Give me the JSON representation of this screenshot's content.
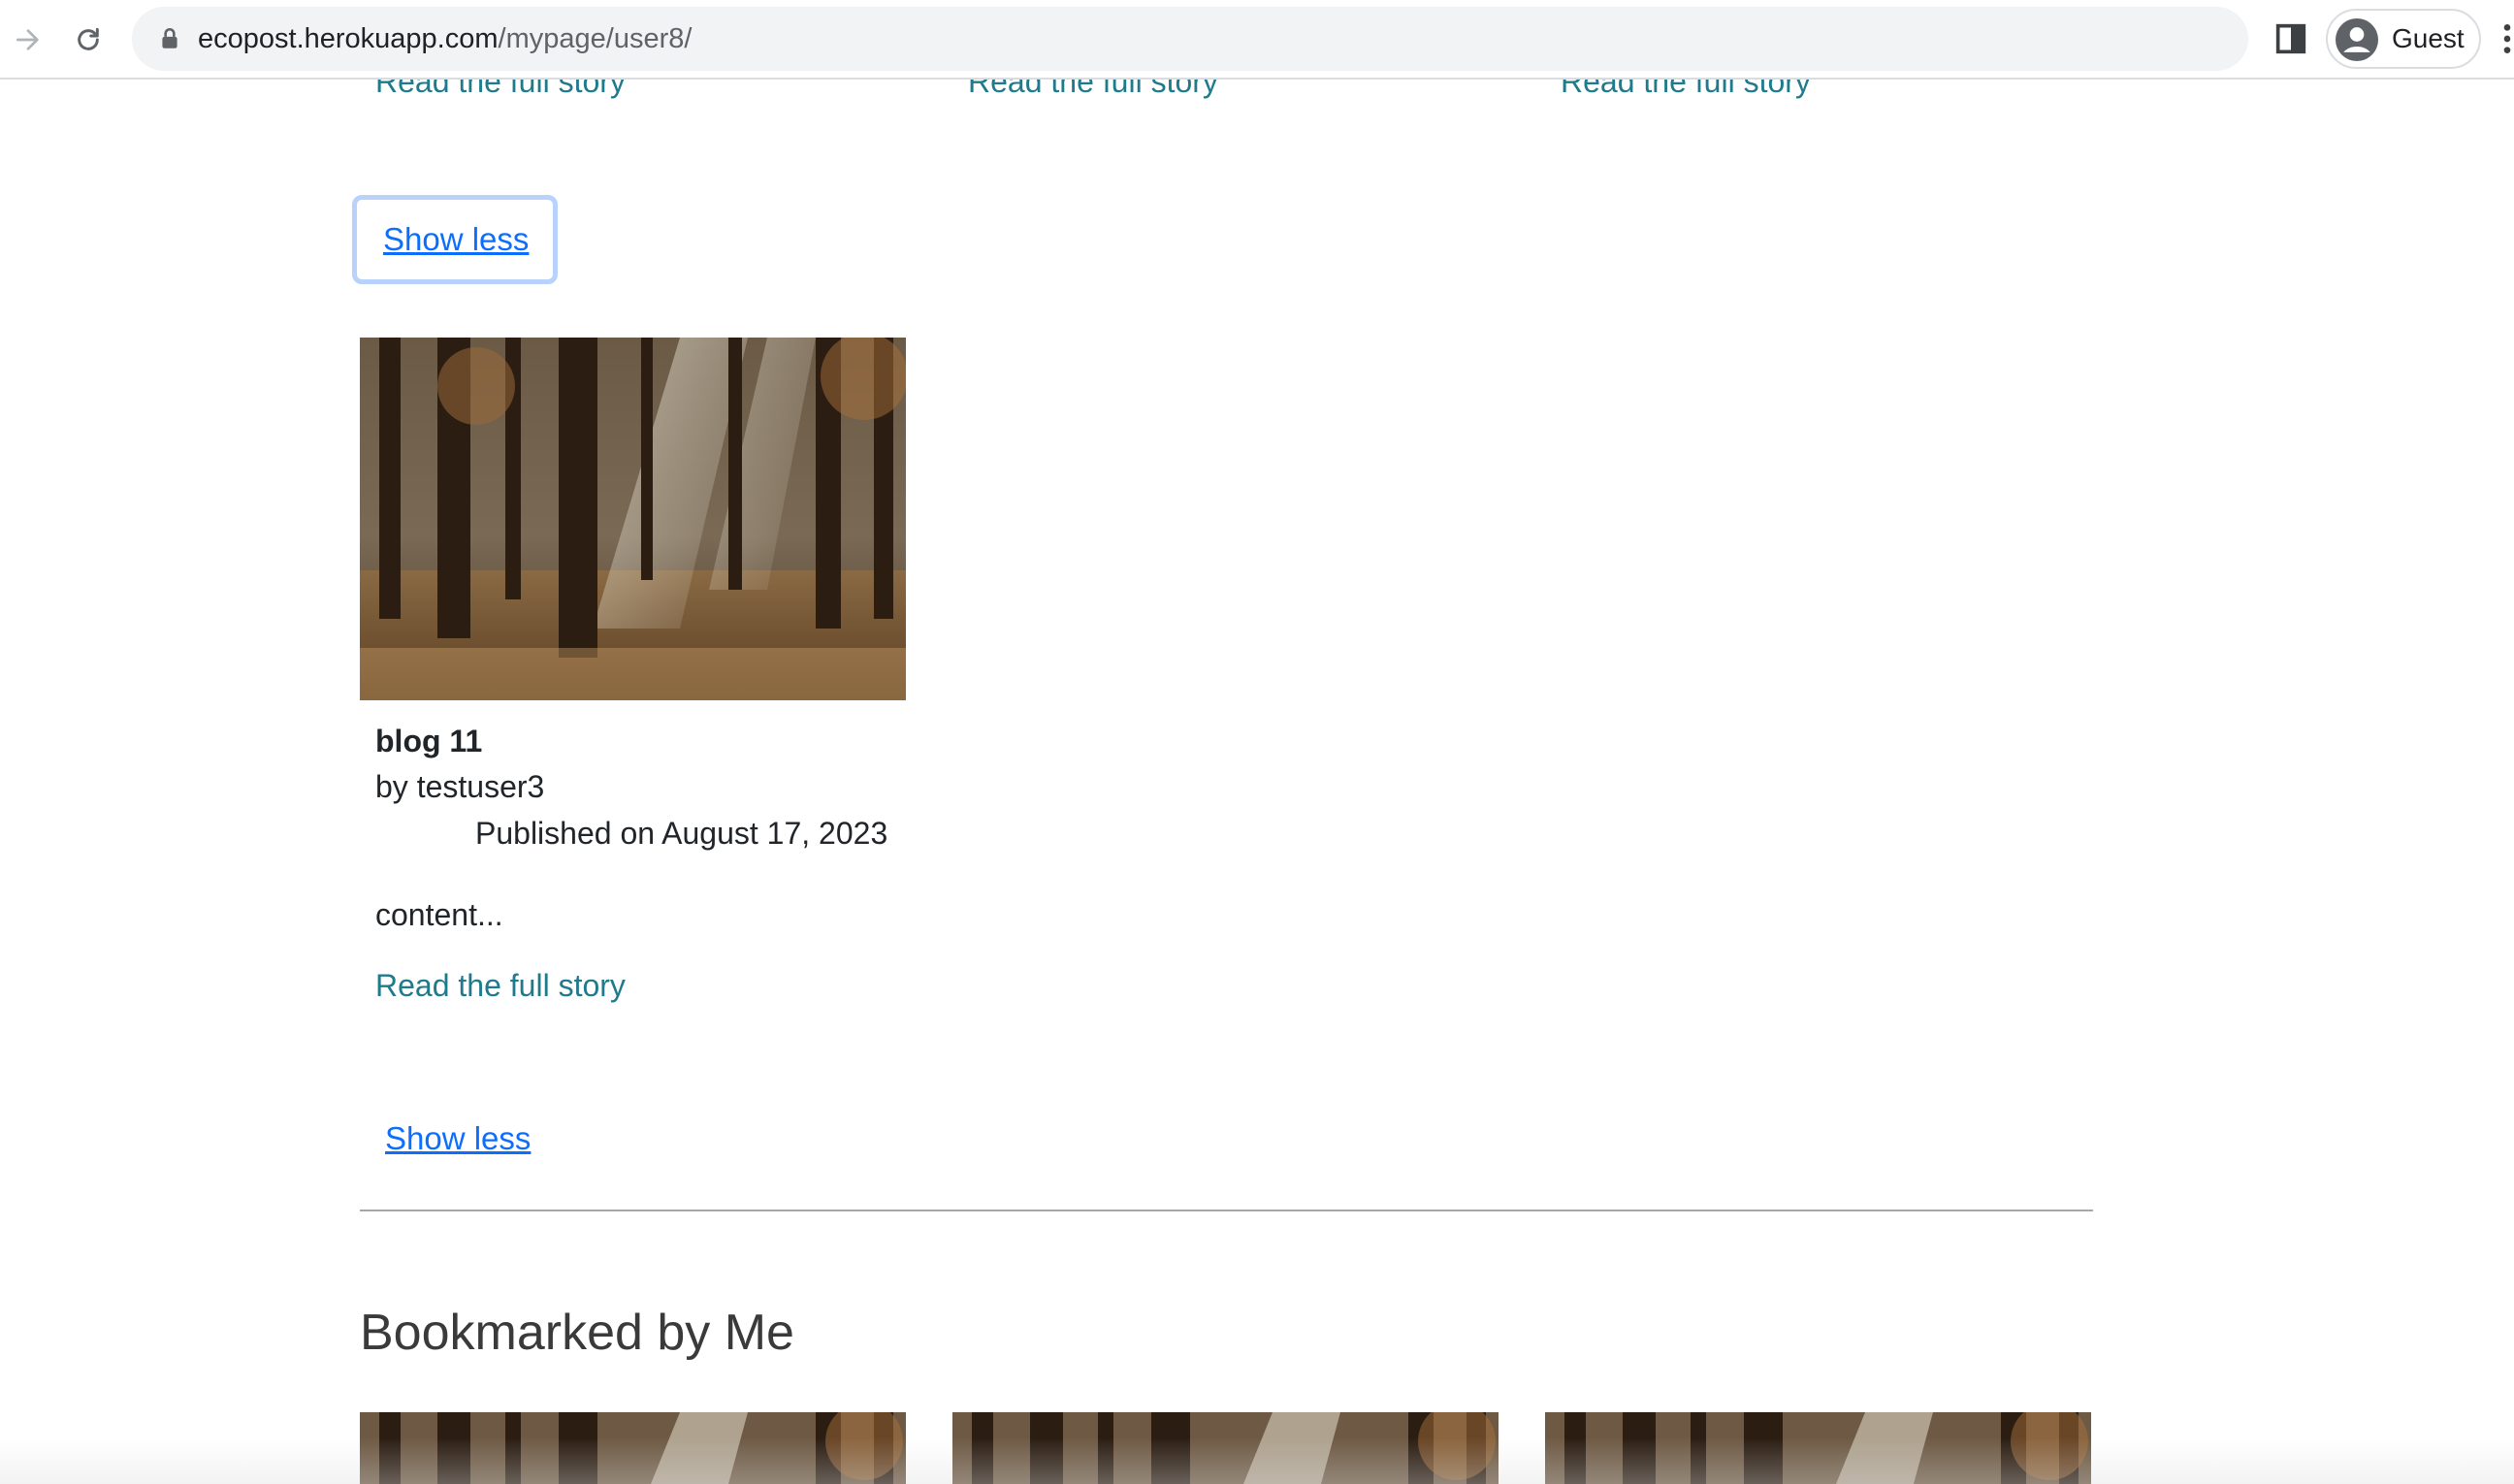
{
  "browser": {
    "url_host": "ecopost.herokuapp.com",
    "url_path": "/mypage/user8/",
    "profile_name": "Guest",
    "icons": [
      "forward-icon",
      "reload-icon",
      "lock-icon",
      "side-panel-icon",
      "avatar-icon",
      "menu-icon"
    ]
  },
  "top_row": {
    "read_more_labels": [
      "Read the full story",
      "Read the full story",
      "Read the full story"
    ]
  },
  "show_less_top": "Show less",
  "post": {
    "title": "blog 11",
    "author": "by testuser3",
    "published": "Published on August 17, 2023",
    "excerpt": "content...",
    "read_more": "Read the full story"
  },
  "show_less_bottom": "Show less",
  "bookmarked": {
    "heading": "Bookmarked by Me",
    "card_count": 3
  },
  "colors": {
    "link_teal": "#1f7a8c",
    "link_blue": "#0d6efd",
    "focus_ring": "#b9d2fb",
    "omnibox_bg": "#f1f3f4"
  }
}
